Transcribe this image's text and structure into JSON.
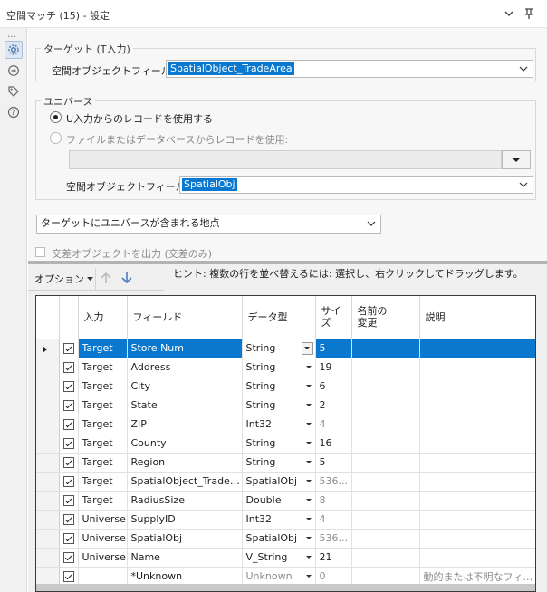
{
  "titlebar": {
    "title": "空間マッチ (15) - 設定",
    "collapse_icon": "chevron-down-icon",
    "pin_icon": "pin-icon"
  },
  "sidebar": {
    "dots": "…",
    "icons": [
      "gear-icon",
      "refresh-arrow-icon",
      "tag-icon",
      "help-icon"
    ]
  },
  "target_group": {
    "title": "ターゲット (T入力)",
    "field_label": "空間オブジェクトフィールド:",
    "field_value": "SpatialObject_TradeArea"
  },
  "universe_group": {
    "title": "ユニバース",
    "radio_u_label": "U入力からのレコードを使用する",
    "radio_file_label": "ファイルまたはデータベースからレコードを使用:",
    "field_label": "空間オブジェクトフィールド:",
    "field_value": "SpatialObj"
  },
  "match_type": {
    "value": "ターゲットにユニバースが含まれる地点"
  },
  "intersect_checkbox": {
    "label": "交差オブジェクトを出力 (交差のみ)"
  },
  "toolbar": {
    "options_label": "オプション",
    "hint": "ヒント: 複数の行を並べ替えるには: 選択し、右クリックしてドラッグします。"
  },
  "grid": {
    "headers": {
      "input": "入力",
      "field": "フィールド",
      "type": "データ型",
      "size_line1": "サイ",
      "size_line2": "ズ",
      "rename_line1": "名前の",
      "rename_line2": "変更",
      "description": "説明"
    },
    "rows": [
      {
        "input": "Target",
        "field": "Store Num",
        "type": "String",
        "size": "5",
        "rename": "",
        "desc": ""
      },
      {
        "input": "Target",
        "field": "Address",
        "type": "String",
        "size": "19",
        "rename": "",
        "desc": ""
      },
      {
        "input": "Target",
        "field": "City",
        "type": "String",
        "size": "6",
        "rename": "",
        "desc": ""
      },
      {
        "input": "Target",
        "field": "State",
        "type": "String",
        "size": "2",
        "rename": "",
        "desc": ""
      },
      {
        "input": "Target",
        "field": "ZIP",
        "type": "Int32",
        "size": "4",
        "rename": "",
        "desc": ""
      },
      {
        "input": "Target",
        "field": "County",
        "type": "String",
        "size": "16",
        "rename": "",
        "desc": ""
      },
      {
        "input": "Target",
        "field": "Region",
        "type": "String",
        "size": "5",
        "rename": "",
        "desc": ""
      },
      {
        "input": "Target",
        "field": "SpatialObject_TradeArea",
        "type": "SpatialObj",
        "size": "536...",
        "rename": "",
        "desc": ""
      },
      {
        "input": "Target",
        "field": "RadiusSize",
        "type": "Double",
        "size": "8",
        "rename": "",
        "desc": ""
      },
      {
        "input": "Universe",
        "field": "SupplyID",
        "type": "Int32",
        "size": "4",
        "rename": "",
        "desc": ""
      },
      {
        "input": "Universe",
        "field": "SpatialObj",
        "type": "SpatialObj",
        "size": "536...",
        "rename": "",
        "desc": ""
      },
      {
        "input": "Universe",
        "field": "Name",
        "type": "V_String",
        "size": "21",
        "rename": "",
        "desc": ""
      },
      {
        "input": "",
        "field": "*Unknown",
        "type": "Unknown",
        "size": "0",
        "rename": "",
        "desc": "動的または不明なフィー..."
      }
    ]
  },
  "colors": {
    "selection": "#0b78d0",
    "panel": "#f7f7f7",
    "splitter": "#b3b3b3"
  }
}
